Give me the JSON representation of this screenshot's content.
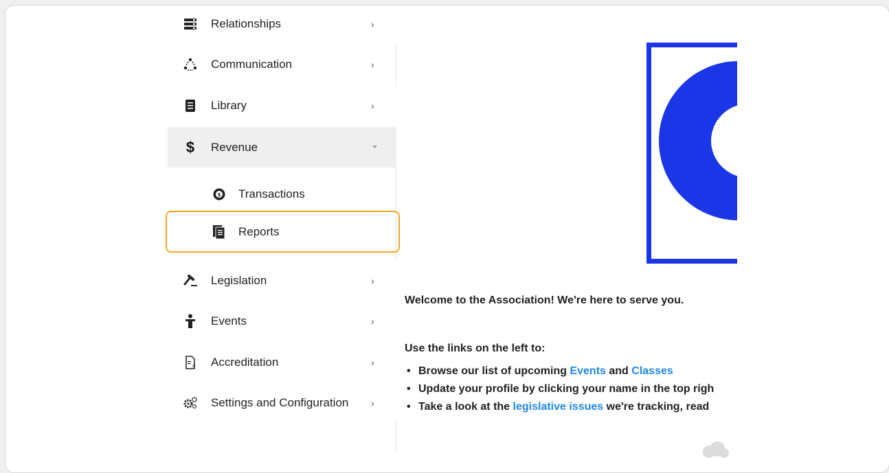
{
  "sidebar": {
    "items": [
      {
        "label": "Relationships",
        "icon": "server-rack-icon",
        "chevron": "›"
      },
      {
        "label": "Communication",
        "icon": "recycle-people-icon",
        "chevron": "›"
      },
      {
        "label": "Library",
        "icon": "document-icon",
        "chevron": "›"
      },
      {
        "label": "Revenue",
        "icon": "dollar-icon",
        "chevron": "⌄"
      },
      {
        "label": "Legislation",
        "icon": "gavel-icon",
        "chevron": "›"
      },
      {
        "label": "Events",
        "icon": "person-podium-icon",
        "chevron": "›"
      },
      {
        "label": "Accreditation",
        "icon": "certificate-icon",
        "chevron": "›"
      },
      {
        "label": "Settings and Configuration",
        "icon": "gears-icon",
        "chevron": "›"
      }
    ],
    "revenue_sub": [
      {
        "label": "Transactions",
        "icon": "money-cycle-icon"
      },
      {
        "label": "Reports",
        "icon": "report-pages-icon"
      }
    ]
  },
  "content": {
    "welcome": "Welcome to the Association!  We're here to serve you.",
    "use_links": "Use the links on the left to:",
    "bullet1": {
      "pre": "Browse our list of upcoming ",
      "link1": "Events",
      "mid": " and ",
      "link2": "Classes"
    },
    "bullet2": {
      "text": "Update your profile by clicking your name in the top righ"
    },
    "bullet3": {
      "pre": "Take a look at the ",
      "link": "legislative issues",
      "post": " we're tracking, read"
    }
  },
  "colors": {
    "highlight": "#f5a623",
    "link": "#1e88e5",
    "logo_blue": "#1a36e6",
    "active_bg": "#efefef"
  }
}
